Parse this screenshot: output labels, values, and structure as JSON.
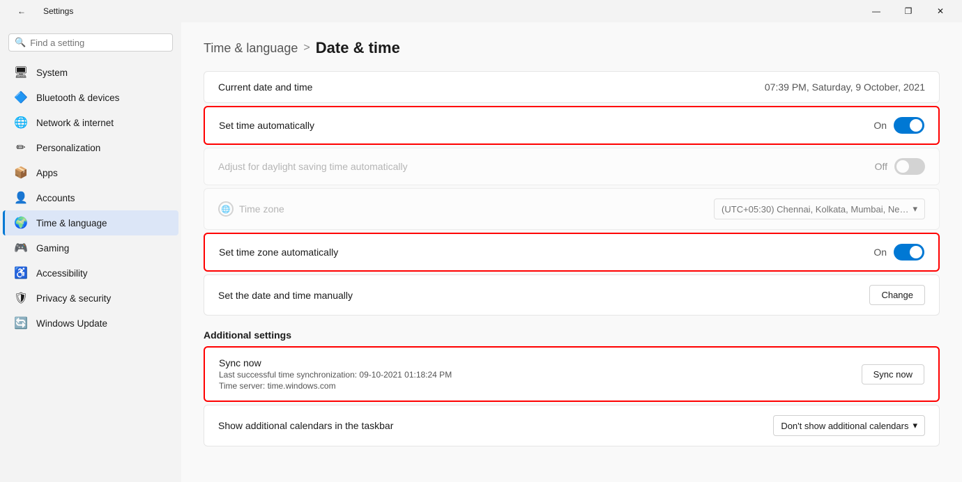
{
  "titlebar": {
    "title": "Settings",
    "back_icon": "←",
    "minimize": "—",
    "maximize": "❐",
    "close": "✕"
  },
  "sidebar": {
    "search_placeholder": "Find a setting",
    "items": [
      {
        "id": "system",
        "label": "System",
        "icon": "🖥",
        "active": false
      },
      {
        "id": "bluetooth",
        "label": "Bluetooth & devices",
        "icon": "🔷",
        "active": false
      },
      {
        "id": "network",
        "label": "Network & internet",
        "icon": "🌐",
        "active": false
      },
      {
        "id": "personalization",
        "label": "Personalization",
        "icon": "✏",
        "active": false
      },
      {
        "id": "apps",
        "label": "Apps",
        "icon": "📦",
        "active": false
      },
      {
        "id": "accounts",
        "label": "Accounts",
        "icon": "👤",
        "active": false
      },
      {
        "id": "timelang",
        "label": "Time & language",
        "icon": "🌍",
        "active": true
      },
      {
        "id": "gaming",
        "label": "Gaming",
        "icon": "🎮",
        "active": false
      },
      {
        "id": "accessibility",
        "label": "Accessibility",
        "icon": "♿",
        "active": false
      },
      {
        "id": "privacy",
        "label": "Privacy & security",
        "icon": "🛡",
        "active": false
      },
      {
        "id": "winupdate",
        "label": "Windows Update",
        "icon": "🔄",
        "active": false
      }
    ]
  },
  "breadcrumb": {
    "parent": "Time & language",
    "separator": ">",
    "current": "Date & time"
  },
  "content": {
    "current_date_label": "Current date and time",
    "current_date_value": "07:39 PM, Saturday, 9 October, 2021",
    "set_time_auto_label": "Set time automatically",
    "set_time_auto_state": "On",
    "set_time_auto_on": true,
    "daylight_label": "Adjust for daylight saving time automatically",
    "daylight_state": "Off",
    "daylight_on": false,
    "timezone_label": "Time zone",
    "timezone_value": "(UTC+05:30) Chennai, Kolkata, Mumbai, Ne…",
    "set_timezone_auto_label": "Set time zone automatically",
    "set_timezone_auto_state": "On",
    "set_timezone_auto_on": true,
    "set_manual_label": "Set the date and time manually",
    "change_button": "Change",
    "additional_settings_header": "Additional settings",
    "sync_title": "Sync now",
    "sync_sub1": "Last successful time synchronization: 09-10-2021 01:18:24 PM",
    "sync_sub2": "Time server: time.windows.com",
    "sync_button": "Sync now",
    "calendars_label": "Show additional calendars in the taskbar",
    "calendars_value": "Don't show additional calendars",
    "calendars_chevron": "▾"
  }
}
